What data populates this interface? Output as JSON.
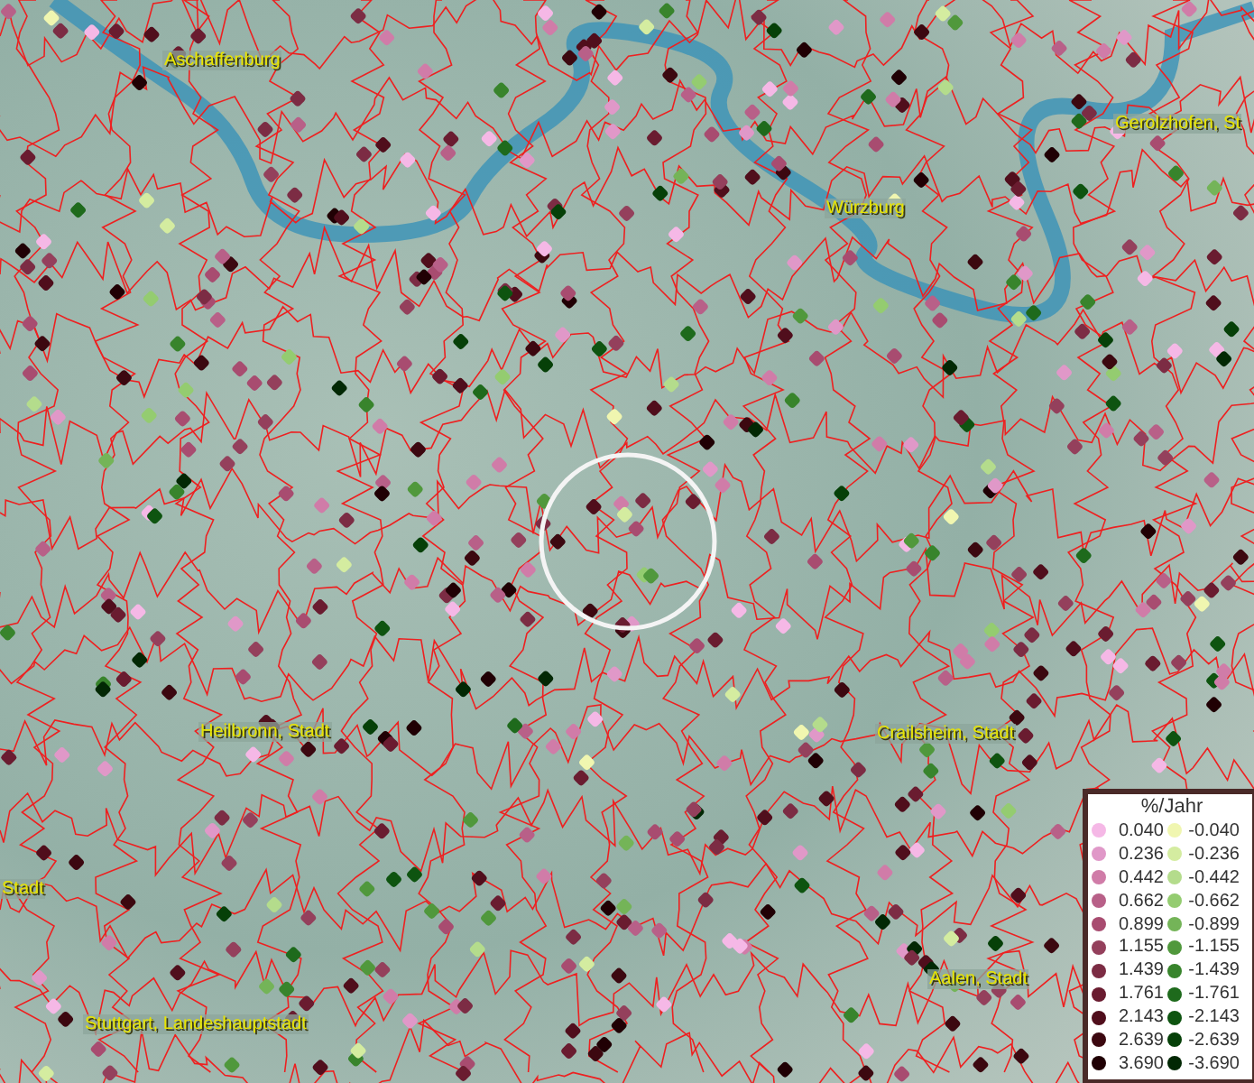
{
  "map": {
    "place_labels": [
      {
        "text": "Aschaffenburg"
      },
      {
        "text": "Gerolzhofen, St"
      },
      {
        "text": "Würzburg"
      },
      {
        "text": "Heilbronn, Stadt"
      },
      {
        "text": "Crailsheim, Stadt"
      },
      {
        "text": "Stadt"
      },
      {
        "text": "Stuttgart, Landeshauptstadt"
      },
      {
        "text": "Aalen, Stadt"
      }
    ]
  },
  "legend": {
    "title": "%/Jahr",
    "columns": [
      [
        {
          "label": "0.040",
          "color": "#f5b8e6"
        },
        {
          "label": "0.236",
          "color": "#e098c8"
        },
        {
          "label": "0.442",
          "color": "#d07ca8"
        },
        {
          "label": "0.662",
          "color": "#b86088"
        },
        {
          "label": "0.899",
          "color": "#a84c70"
        },
        {
          "label": "1.155",
          "color": "#94405c"
        },
        {
          "label": "1.439",
          "color": "#7c2c44"
        },
        {
          "label": "1.761",
          "color": "#6a1c30"
        },
        {
          "label": "2.143",
          "color": "#500e1c"
        },
        {
          "label": "2.639",
          "color": "#3c0810"
        },
        {
          "label": "3.690",
          "color": "#200004"
        }
      ],
      [
        {
          "label": "-0.040",
          "color": "#f0f6b0"
        },
        {
          "label": "-0.236",
          "color": "#d4eca0"
        },
        {
          "label": "-0.442",
          "color": "#b4dc8c"
        },
        {
          "label": "-0.662",
          "color": "#94cc70"
        },
        {
          "label": "-0.899",
          "color": "#74b458"
        },
        {
          "label": "-1.155",
          "color": "#50983c"
        },
        {
          "label": "-1.439",
          "color": "#38842c"
        },
        {
          "label": "-1.761",
          "color": "#1e6a1c"
        },
        {
          "label": "-2.143",
          "color": "#0e5410"
        },
        {
          "label": "-2.639",
          "color": "#064008"
        },
        {
          "label": "-3.690",
          "color": "#022804"
        }
      ]
    ]
  }
}
